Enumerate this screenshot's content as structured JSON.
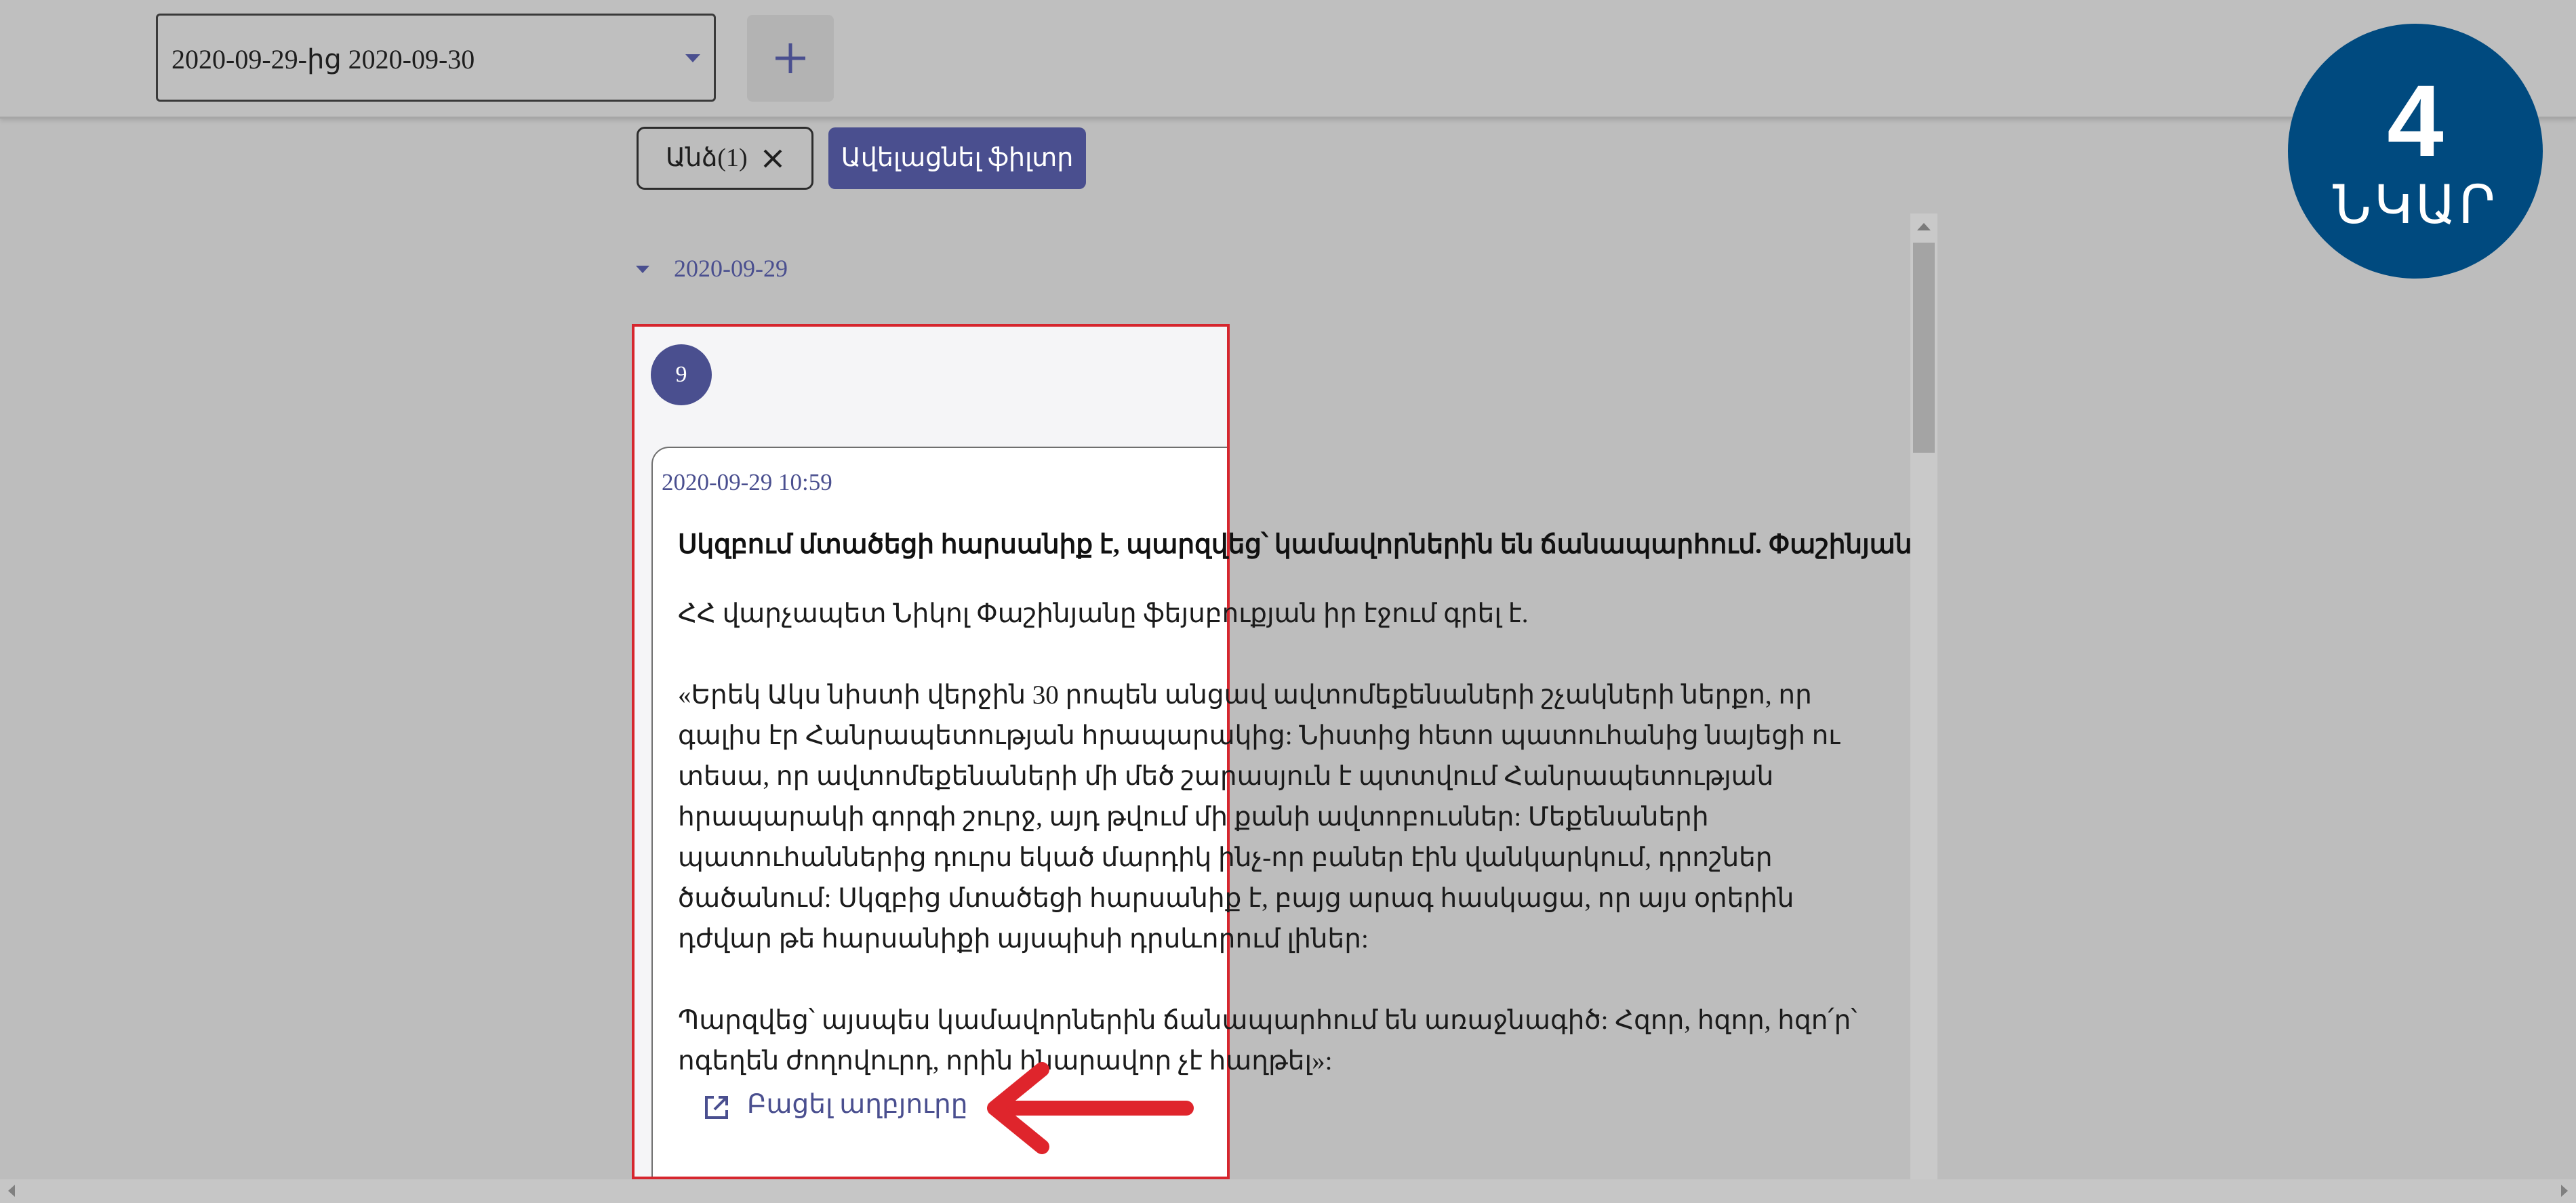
{
  "filters": {
    "date_range_value": "2020-09-29-ից 2020-09-30",
    "add_icon": "plus-icon",
    "active_chip_label": "Անձ(1)",
    "chip_close_icon": "close-icon",
    "apply_button_label": "Ավելացնել ֆիլտր"
  },
  "feed": {
    "group_date": "2020-09-29",
    "item_count": "9",
    "post": {
      "timestamp": "2020-09-29 10:59",
      "title": "Սկզբում մտածեցի հարսանիք է, պարզվեց՝ կամավորներին են ճանապարհում. Փաշինյան",
      "paragraphs": [
        "ՀՀ վարչապետ Նիկոլ Փաշինյանը ֆեյսբուքյան իր էջում գրել է.",
        "«Երեկ Ակս նիստի վերջին 30 րոպեն անցավ ավտոմեքենաների շչակների ներքո, որ գալիս էր Հանրապետության հրապարակից: Նիստից հետո պատուհանից նայեցի ու տեսա, որ ավտոմեքենաների մի մեծ շարասյուն է պտտվում Հանրապետության հրապարակի գորգի շուրջ, այդ թվում մի քանի ավտոբուսներ: Մեքենաների պատուհաններից դուրս եկած մարդիկ ինչ-որ բաներ էին վանկարկում, դրոշներ ծածանում: Սկզբից մտածեցի հարսանիք է, բայց արագ հասկացա, որ այս օրերին դժվար թե հարսանիքի այսպիսի դրսևորում լիներ:",
        "Պարզվեց՝ այսպես կամավորներին ճանապարհում են առաջնագիծ: Հզոր, հզոր, հզո՛ր՝ ոգեղեն ժողովուրդ, որին հնարավոր չէ հաղթել»:"
      ],
      "open_source_label": "Բացել աղբյուրը",
      "open_source_icon": "external-link-icon"
    }
  },
  "step_badge": {
    "number": "4",
    "label": "ՆԿԱՐ"
  },
  "colors": {
    "accent": "#4a4f8f",
    "highlight_frame": "#d6262e",
    "badge": "#004a7f",
    "overlay_gray": "#bdbdbd"
  }
}
